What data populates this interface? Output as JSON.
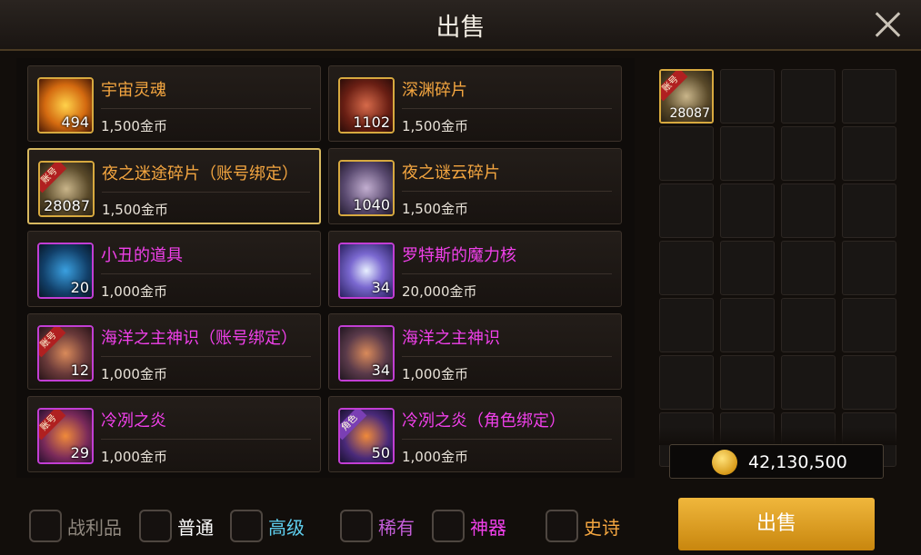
{
  "window": {
    "title": "出售"
  },
  "items": [
    {
      "name": "宇宙灵魂",
      "price": "1,500金币",
      "count": "494",
      "name_color": "orange",
      "icon": "cosmic-soul-icon",
      "icon_bg": "radial-gradient(circle,#ffd24a,#d46a10 55%,#4a1a05)",
      "badge": ""
    },
    {
      "name": "深渊碎片",
      "price": "1,500金币",
      "count": "1102",
      "name_color": "orange",
      "icon": "abyss-shard-icon",
      "icon_bg": "radial-gradient(circle,#d66a4a,#6a1f14 60%,#2a0c08)",
      "badge": ""
    },
    {
      "name": "夜之迷途碎片（账号绑定）",
      "price": "1,500金币",
      "count": "28087",
      "name_color": "orange",
      "icon": "night-maze-shard-icon",
      "icon_bg": "radial-gradient(circle,#c9b58a,#5a4a2a 60%,#2a2214)",
      "badge": "账号",
      "selected": true
    },
    {
      "name": "夜之谜云碎片",
      "price": "1,500金币",
      "count": "1040",
      "name_color": "orange",
      "icon": "night-cloud-shard-icon",
      "icon_bg": "radial-gradient(circle,#c2aed0,#5a4a70 60%,#241c30)",
      "badge": ""
    },
    {
      "name": "小丑的道具",
      "price": "1,000金币",
      "count": "20",
      "name_color": "magenta",
      "icon": "clown-prop-icon",
      "icon_bg": "radial-gradient(circle,#3aa0e0,#12406a 60%,#081828)",
      "badge": ""
    },
    {
      "name": "罗特斯的魔力核",
      "price": "20,000金币",
      "count": "34",
      "name_color": "magenta",
      "icon": "lotus-mana-core-icon",
      "icon_bg": "radial-gradient(circle,#e8f0ff,#7a68d0 45%,#2a2060)",
      "badge": ""
    },
    {
      "name": "海洋之主神识（账号绑定）",
      "price": "1,000金币",
      "count": "12",
      "name_color": "magenta",
      "icon": "ocean-lord-sense-icon",
      "icon_bg": "radial-gradient(circle,#d98a5a,#6a3a3a 55%,#281418)",
      "badge": "账号"
    },
    {
      "name": "海洋之主神识",
      "price": "1,000金币",
      "count": "34",
      "name_color": "magenta",
      "icon": "ocean-lord-sense-icon",
      "icon_bg": "radial-gradient(circle,#d98a5a,#5a3a4a 55%,#201620)",
      "badge": ""
    },
    {
      "name": "冷冽之炎",
      "price": "1,000金币",
      "count": "29",
      "name_color": "magenta",
      "icon": "cold-flame-icon",
      "icon_bg": "radial-gradient(circle,#f08a3a,#7a2a5a 60%,#2a1030)",
      "badge": "账号"
    },
    {
      "name": "冷冽之炎（角色绑定）",
      "price": "1,000金币",
      "count": "50",
      "name_color": "magenta",
      "icon": "cold-flame-icon",
      "icon_bg": "radial-gradient(circle,#f08a3a,#4a2a7a 60%,#1a1030)",
      "badge": "角色"
    }
  ],
  "sell_slots": {
    "first": {
      "count": "28087",
      "badge": "账号",
      "icon": "night-maze-shard-icon"
    }
  },
  "gold": {
    "amount": "42,130,500",
    "icon": "gold-coin-icon"
  },
  "filters": [
    {
      "label": "战利品",
      "color": "#8f877e"
    },
    {
      "label": "普通",
      "color": "#ffffff"
    },
    {
      "label": "高级",
      "color": "#5fd0f0"
    },
    {
      "label": "稀有",
      "color": "#c45ed8"
    },
    {
      "label": "神器",
      "color": "#f040ea"
    },
    {
      "label": "史诗",
      "color": "#f4a640"
    }
  ],
  "sell_button": {
    "label": "出售"
  },
  "colors": {
    "accent": "#d7b860",
    "button": "#e3a529"
  }
}
